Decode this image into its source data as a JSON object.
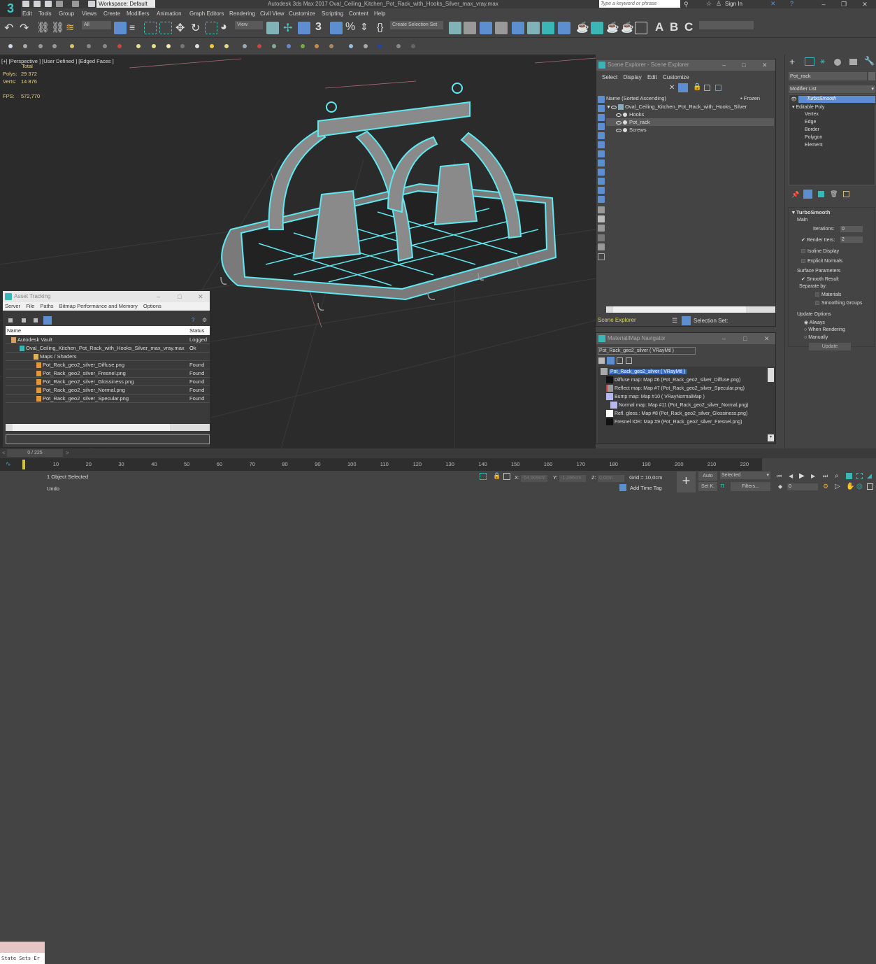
{
  "app": {
    "title": "Autodesk 3ds Max 2017    Oval_Ceiling_Kitchen_Pot_Rack_with_Hooks_Silver_max_vray.max",
    "logo": "3",
    "workspace": "Workspace: Default",
    "search_placeholder": "Type a keyword or phrase",
    "sign_in": "Sign In",
    "window_controls": [
      "–",
      "❐",
      "✕"
    ]
  },
  "menu": [
    "Edit",
    "Tools",
    "Group",
    "Views",
    "Create",
    "Modifiers",
    "Animation",
    "Graph Editors",
    "Rendering",
    "Civil View",
    "Customize",
    "Scripting",
    "Content",
    "Help"
  ],
  "toolbar": {
    "selection_filter": "All",
    "ref_coord": "View",
    "selection_set": "Create Selection Set",
    "render_letters": [
      "A",
      "B",
      "C"
    ]
  },
  "viewport": {
    "label": "[+] [Perspective ] [User Defined ] [Edged Faces ]",
    "stats_header": "Total",
    "polys_label": "Polys:",
    "polys": "29 372",
    "verts_label": "Verts:",
    "verts": "14 876",
    "fps_label": "FPS:",
    "fps": "572,770"
  },
  "scene_explorer": {
    "title": "Scene Explorer - Scene Explorer",
    "menu": [
      "Select",
      "Display",
      "Edit",
      "Customize"
    ],
    "col_name": "Name (Sorted Ascending)",
    "col_frozen": "▪ Frozen",
    "root": "Oval_Ceiling_Kitchen_Pot_Rack_with_Hooks_Silver",
    "children": [
      "Hooks",
      "Pot_rack",
      "Screws"
    ],
    "selected_child": "Pot_rack",
    "footer_label": "Scene Explorer",
    "selection_set_label": "Selection Set:"
  },
  "command_panel": {
    "object_name": "Pot_rack",
    "modifier_list": "Modifier List",
    "stack": [
      "TurboSmooth",
      "Editable Poly"
    ],
    "subobjects": [
      "Vertex",
      "Edge",
      "Border",
      "Polygon",
      "Element"
    ],
    "turbosmooth": {
      "title": "TurboSmooth",
      "main": "Main",
      "iterations_label": "Iterations:",
      "iterations": "0",
      "render_iters_label": "Render Iters:",
      "render_iters": "2",
      "render_iters_checked": true,
      "isoline_display": "Isoline Display",
      "explicit_normals": "Explicit Normals",
      "surface_params": "Surface Parameters",
      "smooth_result": "Smooth Result",
      "separate_by": "Separate by:",
      "materials": "Materials",
      "smoothing_groups": "Smoothing Groups",
      "update_options": "Update Options",
      "always": "Always",
      "when_rendering": "When Rendering",
      "manually": "Manually",
      "update_button": "Update"
    }
  },
  "asset_tracking": {
    "title": "Asset Tracking",
    "menu": [
      "Server",
      "File",
      "Paths",
      "Bitmap Performance and Memory",
      "Options"
    ],
    "col_name": "Name",
    "col_status": "Status",
    "rows": [
      {
        "name": "Autodesk Vault",
        "status": "Logged O"
      },
      {
        "name": "Oval_Ceiling_Kitchen_Pot_Rack_with_Hooks_Silver_max_vray.max",
        "status": "Ok"
      },
      {
        "name": "Maps / Shaders",
        "status": ""
      },
      {
        "name": "Pot_Rack_geo2_silver_Diffuse.png",
        "status": "Found"
      },
      {
        "name": "Pot_Rack_geo2_silver_Fresnel.png",
        "status": "Found"
      },
      {
        "name": "Pot_Rack_geo2_silver_Glossiness.png",
        "status": "Found"
      },
      {
        "name": "Pot_Rack_geo2_silver_Normal.png",
        "status": "Found"
      },
      {
        "name": "Pot_Rack_geo2_silver_Specular.png",
        "status": "Found"
      }
    ]
  },
  "material_navigator": {
    "title": "Material/Map Navigator",
    "current": "Pot_Rack_geo2_silver  ( VRayMtl )",
    "root": "Pot_Rack_geo2_silver  ( VRayMtl )",
    "maps": [
      "Diffuse map: Map #6 (Pot_Rack_geo2_silver_Diffuse.png)",
      "Reflect map: Map #7 (Pot_Rack_geo2_silver_Specular.png)",
      "Bump map: Map #10  ( VRayNormalMap )",
      "Normal map: Map #11 (Pot_Rack_geo2_silver_Normal.png)",
      "Refl. gloss.: Map #8 (Pot_Rack_geo2_silver_Glossiness.png)",
      "Fresnel IOR: Map #9 (Pot_Rack_geo2_silver_Fresnel.png)"
    ]
  },
  "timeline": {
    "frame_counter": "0 / 225",
    "current_frame": 0,
    "total_frames": 225,
    "ticks": [
      "0",
      "10",
      "20",
      "30",
      "40",
      "50",
      "60",
      "70",
      "80",
      "90",
      "100",
      "110",
      "120",
      "130",
      "140",
      "150",
      "160",
      "170",
      "180",
      "190",
      "200",
      "210",
      "220"
    ]
  },
  "status": {
    "maxscript": "State Sets Er",
    "selected": "1 Object Selected",
    "prompt": "Undo",
    "x_label": "X:",
    "x": "-54,909cm",
    "y_label": "Y:",
    "y": "-1,286cm",
    "z_label": "Z:",
    "z": "0,0cm",
    "grid": "Grid = 10,0cm",
    "add_time_tag": "Add Time Tag",
    "auto": "Auto",
    "setk": "Set K.",
    "key_filter": "Selected",
    "filters": "Filters...",
    "frame_field": "0"
  },
  "colors": {
    "accent": "#5d8ecf",
    "selection_wire": "#5ee8f0",
    "stats_text": "#e8d37a",
    "teal_icon": "#3bb6b6"
  }
}
